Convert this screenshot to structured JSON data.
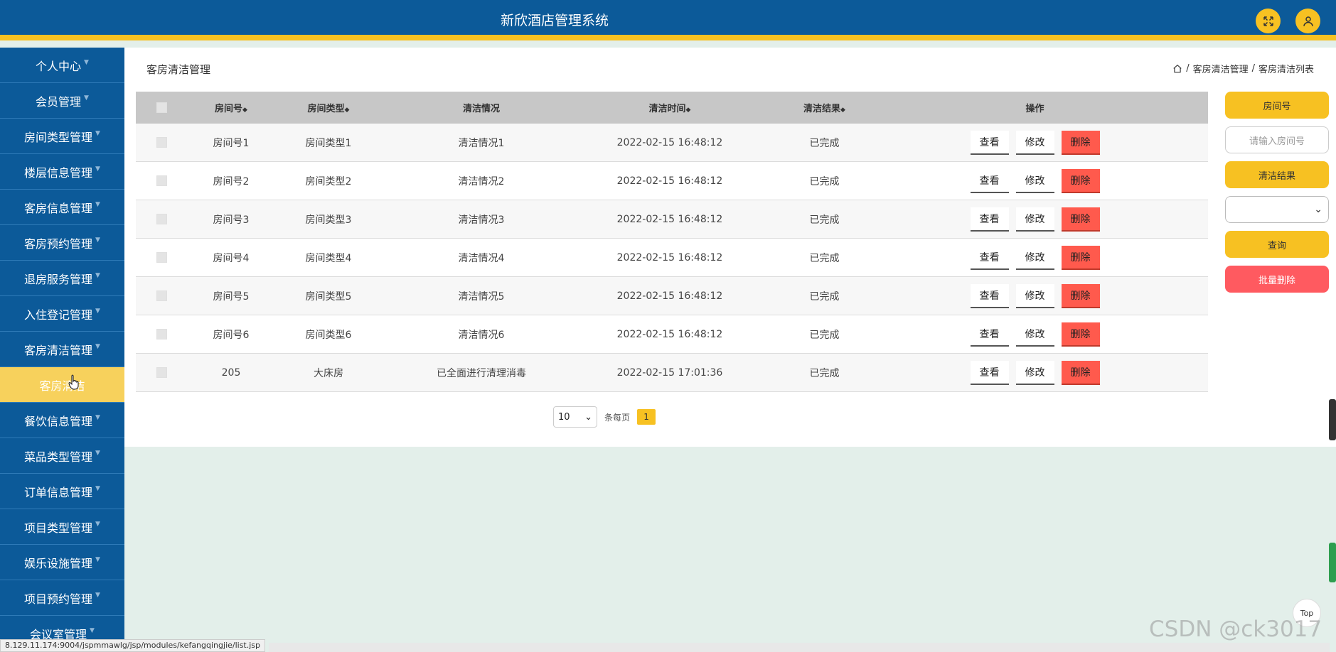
{
  "header": {
    "title": "新欣酒店管理系统"
  },
  "sidebar": {
    "items": [
      {
        "label": "个人中心"
      },
      {
        "label": "会员管理"
      },
      {
        "label": "房间类型管理"
      },
      {
        "label": "楼层信息管理"
      },
      {
        "label": "客房信息管理"
      },
      {
        "label": "客房预约管理"
      },
      {
        "label": "退房服务管理"
      },
      {
        "label": "入住登记管理"
      },
      {
        "label": "客房清洁管理"
      },
      {
        "label": "客房清洁"
      },
      {
        "label": "餐饮信息管理"
      },
      {
        "label": "菜品类型管理"
      },
      {
        "label": "订单信息管理"
      },
      {
        "label": "项目类型管理"
      },
      {
        "label": "娱乐设施管理"
      },
      {
        "label": "项目预约管理"
      },
      {
        "label": "会议室管理"
      }
    ]
  },
  "main": {
    "page_title": "客房清洁管理",
    "breadcrumb": [
      "客房清洁管理",
      "客房清洁列表"
    ],
    "table": {
      "headers": {
        "room": "房间号",
        "type": "房间类型",
        "clean": "清洁情况",
        "time": "清洁时间",
        "result": "清洁结果",
        "ops": "操作"
      },
      "rows": [
        {
          "room": "房间号1",
          "type": "房间类型1",
          "clean": "清洁情况1",
          "time": "2022-02-15 16:48:12",
          "result": "已完成"
        },
        {
          "room": "房间号2",
          "type": "房间类型2",
          "clean": "清洁情况2",
          "time": "2022-02-15 16:48:12",
          "result": "已完成"
        },
        {
          "room": "房间号3",
          "type": "房间类型3",
          "clean": "清洁情况3",
          "time": "2022-02-15 16:48:12",
          "result": "已完成"
        },
        {
          "room": "房间号4",
          "type": "房间类型4",
          "clean": "清洁情况4",
          "time": "2022-02-15 16:48:12",
          "result": "已完成"
        },
        {
          "room": "房间号5",
          "type": "房间类型5",
          "clean": "清洁情况5",
          "time": "2022-02-15 16:48:12",
          "result": "已完成"
        },
        {
          "room": "房间号6",
          "type": "房间类型6",
          "clean": "清洁情况6",
          "time": "2022-02-15 16:48:12",
          "result": "已完成"
        },
        {
          "room": "205",
          "type": "大床房",
          "clean": "已全面进行清理消毒",
          "time": "2022-02-15 17:01:36",
          "result": "已完成"
        }
      ],
      "actions": {
        "view": "查看",
        "edit": "修改",
        "delete": "删除"
      }
    },
    "pager": {
      "page_size": "10",
      "per_page_label": "条每页",
      "current_page": "1"
    }
  },
  "search": {
    "room_label": "房间号",
    "room_placeholder": "请输入房间号",
    "result_label": "清洁结果",
    "result_value": "",
    "query_button": "查询",
    "batch_delete_button": "批量删除"
  },
  "misc": {
    "top_button": "Top",
    "watermark": "CSDN @ck3017",
    "status_url": "8.129.11.174:9004/jspmmawlg/jsp/modules/kefangqingjie/list.jsp"
  },
  "colors": {
    "primary": "#0c5a99",
    "accent": "#f7c122",
    "danger": "#ff5a4d"
  }
}
